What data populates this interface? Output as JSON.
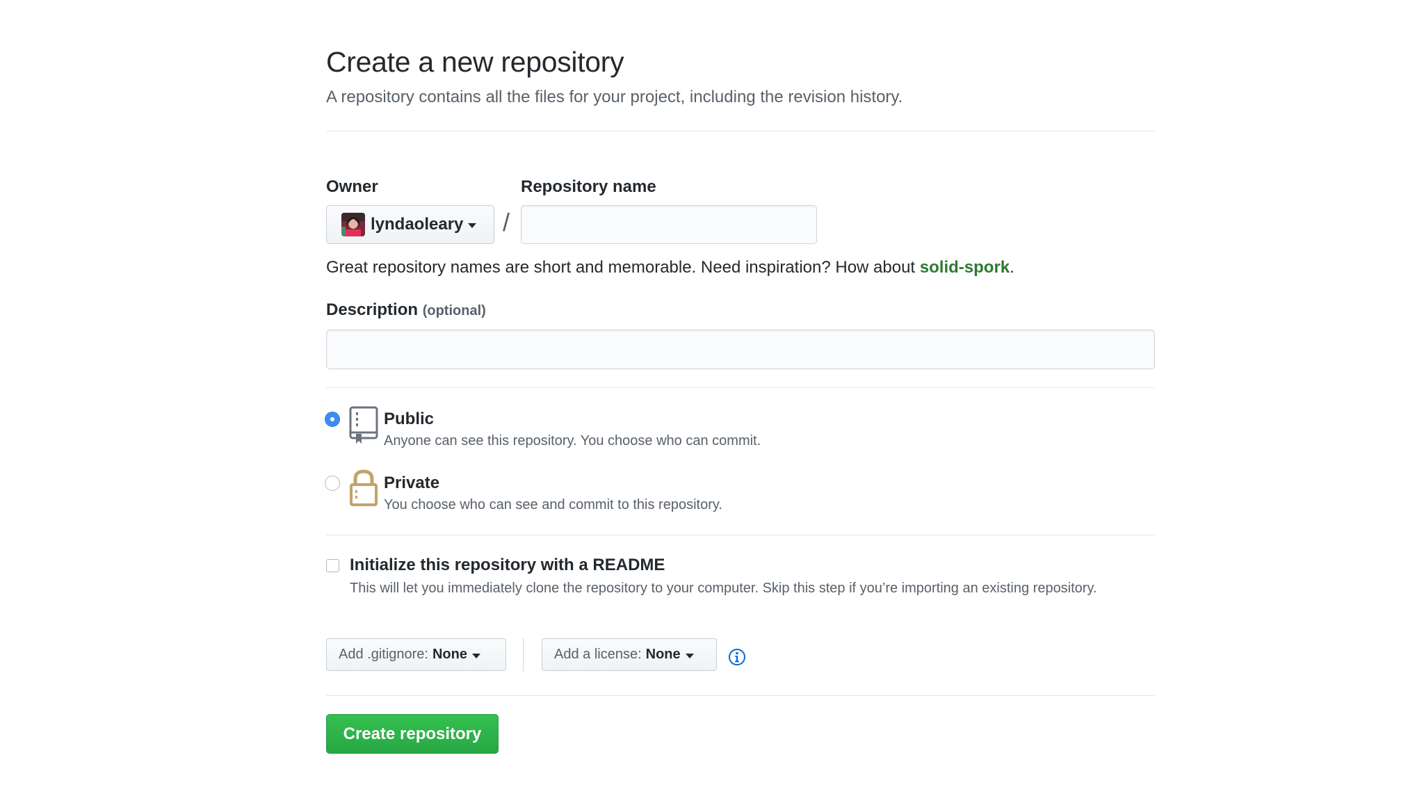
{
  "header": {
    "title": "Create a new repository",
    "subtitle": "A repository contains all the files for your project, including the revision history."
  },
  "owner": {
    "label": "Owner",
    "selected": "lyndaoleary"
  },
  "separator": "/",
  "repo_name": {
    "label": "Repository name",
    "value": "",
    "placeholder": ""
  },
  "name_hint": {
    "prefix": "Great repository names are short and memorable. Need inspiration? How about ",
    "suggestion": "solid-spork",
    "suffix": "."
  },
  "description": {
    "label": "Description",
    "optional": "(optional)",
    "value": "",
    "placeholder": ""
  },
  "visibility": {
    "selected": "public",
    "options": [
      {
        "title": "Public",
        "description": "Anyone can see this repository. You choose who can commit.",
        "icon": "repo-book-icon"
      },
      {
        "title": "Private",
        "description": "You choose who can see and commit to this repository.",
        "icon": "lock-icon"
      }
    ]
  },
  "initialize": {
    "checked": false,
    "title": "Initialize this repository with a README",
    "description": "This will let you immediately clone the repository to your computer. Skip this step if you’re importing an existing repository."
  },
  "gitignore": {
    "label": "Add .gitignore:",
    "value": "None"
  },
  "license": {
    "label": "Add a license:",
    "value": "None"
  },
  "info_icon": "info-icon",
  "submit": {
    "label": "Create repository"
  },
  "colors": {
    "accent_blue": "#3b8ef0",
    "success_green": "#28a745",
    "suggestion_green": "#2c7a30",
    "lock_tan": "#c2a36a"
  }
}
